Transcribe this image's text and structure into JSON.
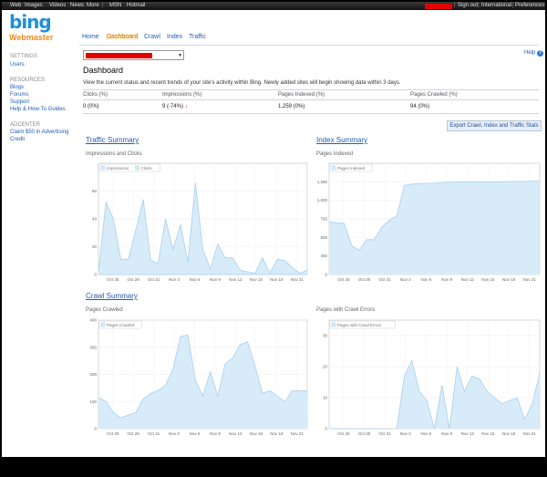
{
  "topbar": {
    "links": [
      "Web",
      "Images",
      "Videos",
      "News",
      "More",
      "MSN",
      "Hotmail"
    ],
    "right_links": [
      "Sign out",
      "International",
      "Preferences"
    ]
  },
  "logo": {
    "brand": "bing",
    "product": "Webmaster"
  },
  "nav": {
    "items": [
      "Home",
      "Dashboard",
      "Crawl",
      "Index",
      "Traffic"
    ],
    "active": "Dashboard"
  },
  "help": {
    "label": "Help",
    "icon": "?"
  },
  "sidebar": {
    "settings_header": "SETTINGS",
    "settings_items": [
      "Users"
    ],
    "resources_header": "RESOURCES",
    "resources_items": [
      "Blogs",
      "Forums",
      "Support",
      "Help & How-To Guides"
    ],
    "adcenter_header": "ADCENTER",
    "adcenter_items": [
      "Claim $50 in Advertising",
      "Credit"
    ]
  },
  "main": {
    "title": "Dashboard",
    "description": "View the current status and recent trends of your site's activity within Bing. Newly added sites will begin showing data within 3 days.",
    "stats": {
      "headers": [
        "Clicks (%)",
        "Impressions (%)",
        "Pages Indexed (%)",
        "Pages Crawled (%)"
      ],
      "values": [
        "0 (0%)",
        "9 (-74%)",
        "1,259 (0%)",
        "94 (0%)"
      ]
    },
    "export_button": "Export Crawl, Index and Traffic Stats",
    "traffic_section": "Traffic Summary",
    "index_section": "Index Summary",
    "crawl_section": "Crawl Summary"
  },
  "colors": {
    "area_fill": "#d7ebf9",
    "area_line": "#a8d0ee",
    "accent": "#1e5db3",
    "active_tab": "#c56400"
  },
  "chart_data": [
    {
      "type": "area",
      "title": "Impressions and Clicks",
      "x_ticks": [
        "Oct 25",
        "Oct 28",
        "Oct 31",
        "Nov 3",
        "Nov 6",
        "Nov 9",
        "Nov 12",
        "Nov 15",
        "Nov 18",
        "Nov 21"
      ],
      "y_ticks": [
        0,
        20,
        40,
        60
      ],
      "ylim": [
        0,
        80
      ],
      "series": [
        {
          "name": "Impressions",
          "values": [
            2,
            52,
            40,
            11,
            11,
            32,
            54,
            10,
            8,
            40,
            18,
            36,
            9,
            66,
            18,
            4,
            22,
            12,
            12,
            3,
            2,
            1,
            12,
            1,
            11,
            10,
            5,
            1,
            3
          ]
        },
        {
          "name": "Clicks",
          "values": [
            0,
            0,
            0,
            0,
            0,
            0,
            0,
            0,
            0,
            0,
            0,
            0,
            0,
            0,
            0,
            0,
            0,
            0,
            0,
            0,
            0,
            0,
            0,
            0,
            0,
            0,
            0,
            0,
            0
          ]
        }
      ]
    },
    {
      "type": "area",
      "title": "Pages Indexed",
      "x_ticks": [
        "Oct 25",
        "Oct 28",
        "Oct 31",
        "Nov 3",
        "Nov 6",
        "Nov 9",
        "Nov 12",
        "Nov 15",
        "Nov 18",
        "Nov 21"
      ],
      "y_ticks": [
        0,
        250,
        500,
        750,
        1000,
        1250
      ],
      "ylim": [
        0,
        1500
      ],
      "series": [
        {
          "name": "Pages Indexed",
          "values": [
            710,
            700,
            690,
            390,
            330,
            470,
            470,
            640,
            730,
            790,
            1200,
            1220,
            1225,
            1230,
            1230,
            1240,
            1245,
            1245,
            1250,
            1250,
            1250,
            1250,
            1250,
            1252,
            1252,
            1255,
            1255,
            1258,
            1259
          ]
        }
      ]
    },
    {
      "type": "area",
      "title": "Pages Crawled",
      "x_ticks": [
        "Oct 25",
        "Oct 28",
        "Oct 31",
        "Nov 3",
        "Nov 6",
        "Nov 9",
        "Nov 12",
        "Nov 15",
        "Nov 18",
        "Nov 21"
      ],
      "y_ticks": [
        0,
        100,
        200,
        300,
        400
      ],
      "ylim": [
        0,
        400
      ],
      "series": [
        {
          "name": "Pages Crawled",
          "values": [
            115,
            100,
            60,
            40,
            50,
            60,
            110,
            130,
            140,
            160,
            220,
            340,
            345,
            180,
            120,
            210,
            120,
            240,
            260,
            310,
            320,
            230,
            130,
            140,
            120,
            100,
            140,
            140,
            140
          ]
        }
      ]
    },
    {
      "type": "area",
      "title": "Pages with Crawl Errors",
      "x_ticks": [
        "Oct 25",
        "Oct 28",
        "Oct 31",
        "Nov 3",
        "Nov 6",
        "Nov 9",
        "Nov 12",
        "Nov 15",
        "Nov 18",
        "Nov 21"
      ],
      "y_ticks": [
        0,
        10,
        20,
        30
      ],
      "ylim": [
        0,
        35
      ],
      "series": [
        {
          "name": "Pages with Crawl Errors",
          "values": [
            0,
            0,
            0,
            0,
            0,
            0,
            0,
            0,
            0,
            0,
            17,
            22,
            12,
            9,
            0,
            14,
            0,
            20,
            12,
            17,
            16,
            12,
            10,
            8,
            9,
            10,
            3,
            8,
            18
          ]
        }
      ]
    }
  ]
}
